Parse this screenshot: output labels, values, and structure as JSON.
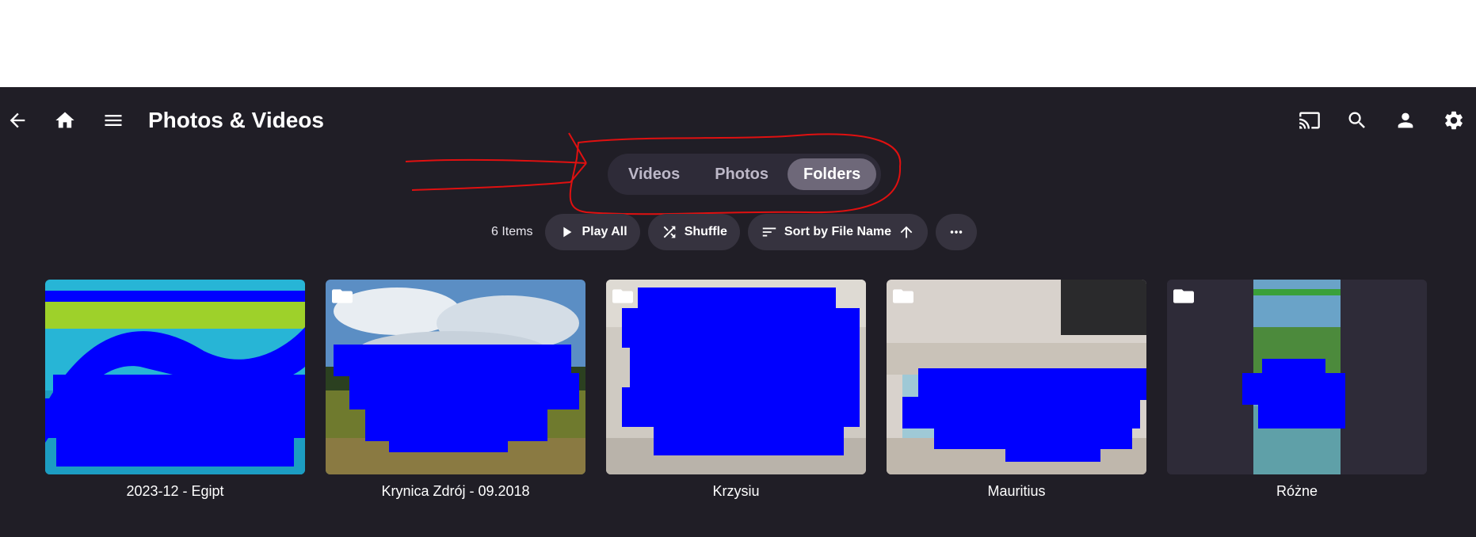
{
  "header": {
    "title": "Photos & Videos",
    "left_icons": [
      "arrow-left-icon",
      "home-icon",
      "menu-icon"
    ],
    "right_icons": [
      "cast-icon",
      "search-icon",
      "user-icon",
      "settings-icon"
    ]
  },
  "tabs": [
    {
      "label": "Videos",
      "active": false
    },
    {
      "label": "Photos",
      "active": false
    },
    {
      "label": "Folders",
      "active": true
    }
  ],
  "toolbar": {
    "count": "6 Items",
    "play_all": "Play All",
    "shuffle": "Shuffle",
    "sort": "Sort by File Name"
  },
  "folders": [
    {
      "name": "2023-12 - Egipt"
    },
    {
      "name": "Krynica Zdrój - 09.2018"
    },
    {
      "name": "Krzysiu"
    },
    {
      "name": "Mauritius"
    },
    {
      "name": "Różne"
    }
  ],
  "colors": {
    "background": "#201e26",
    "annotation": "#e01010",
    "redaction": "#0000ff",
    "active_tab": "#6e6879"
  }
}
